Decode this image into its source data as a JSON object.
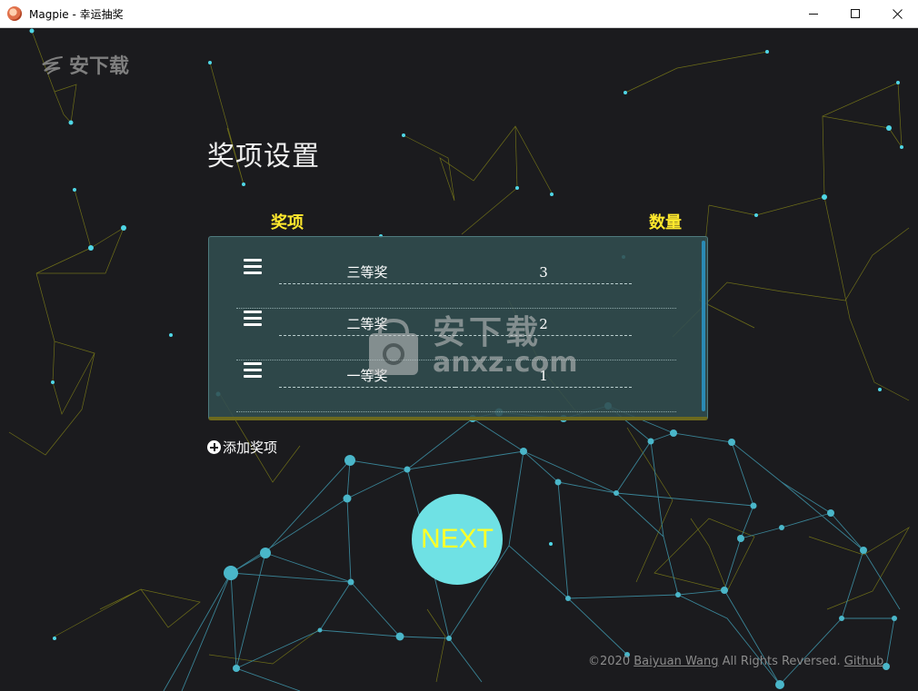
{
  "window": {
    "title": "Magpie - 幸运抽奖",
    "app_icon": "magpie-app-icon",
    "controls": [
      "minimize-icon",
      "maximize-icon",
      "close-icon"
    ]
  },
  "logo": {
    "text": "安下载",
    "icon": "bird-wing-icon"
  },
  "page": {
    "heading": "奖项设置",
    "columns": {
      "prize": "奖项",
      "quantity": "数量"
    }
  },
  "prizes": [
    {
      "name": "三等奖",
      "quantity": "3"
    },
    {
      "name": "二等奖",
      "quantity": "2"
    },
    {
      "name": "一等奖",
      "quantity": "1"
    }
  ],
  "add_prize": {
    "label": "添加奖项",
    "icon": "plus-circle-icon"
  },
  "next_button": {
    "label": "NEXT"
  },
  "watermark": {
    "cn": "安下载",
    "en": "anxz.com"
  },
  "footer": {
    "prefix": "©2020 ",
    "author": "Baiyuan Wang",
    "middle": " All Rights Reversed. ",
    "link": "Github"
  },
  "colors": {
    "background": "#1b1b1e",
    "accent_yellow": "#ffe92d",
    "next_button_bg": "#6fe1e4",
    "next_button_text": "#ffff29",
    "panel_bg": "#314d50",
    "network_cyan": "#4ab6c9",
    "network_olive": "#8a8a1a"
  }
}
